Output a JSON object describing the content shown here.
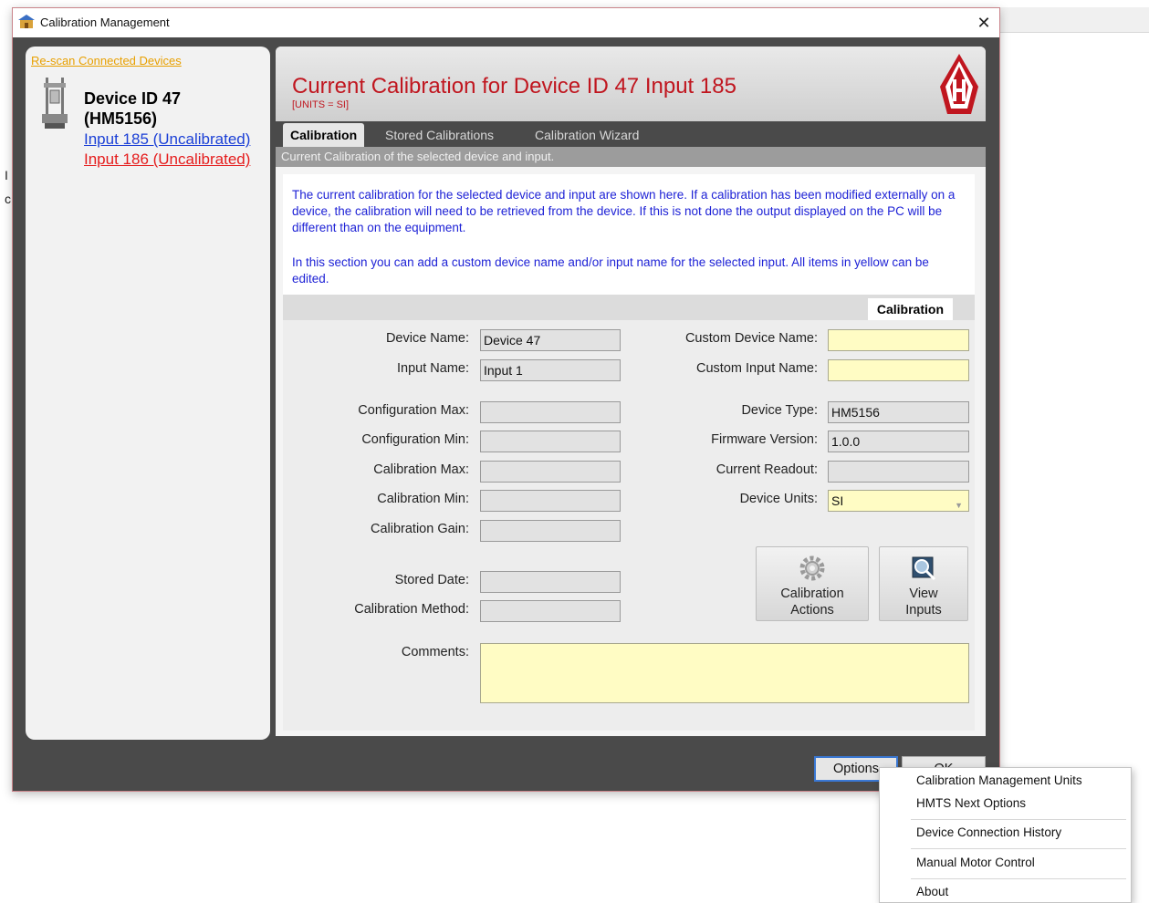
{
  "window": {
    "title": "Calibration Management",
    "close_glyph": "✕"
  },
  "left_panel": {
    "rescan_link": "Re-scan Connected Devices",
    "device_title_line1": "Device ID 47",
    "device_title_line2": "(HM5156)",
    "input_185": "Input 185 (Uncalibrated)",
    "input_186": "Input 186 (Uncalibrated)"
  },
  "header": {
    "title": "Current Calibration for Device ID 47 Input 185",
    "units": "[UNITS = SI]"
  },
  "tabs": [
    {
      "label": "Calibration",
      "active": true
    },
    {
      "label": "Stored Calibrations",
      "active": false
    },
    {
      "label": "Calibration Wizard",
      "active": false
    }
  ],
  "subheader": "Current Calibration of the selected device and input.",
  "descriptions": {
    "p1": "The current calibration for the selected device and input are shown here.  If a calibration has been modified externally on a device, the calibration will need to be retrieved from the device.  If this is not done the output displayed on the PC will be different than on the equipment.",
    "p2": "In this section you can add a custom device name and/or input name for the selected input.  All items in yellow can be edited."
  },
  "section_tab": "Calibration",
  "fields": {
    "device_name": {
      "label": "Device Name:",
      "value": "Device 47"
    },
    "input_name": {
      "label": "Input Name:",
      "value": "Input 1"
    },
    "config_max": {
      "label": "Configuration Max:",
      "value": ""
    },
    "config_min": {
      "label": "Configuration Min:",
      "value": ""
    },
    "cal_max": {
      "label": "Calibration Max:",
      "value": ""
    },
    "cal_min": {
      "label": "Calibration Min:",
      "value": ""
    },
    "cal_gain": {
      "label": "Calibration Gain:",
      "value": ""
    },
    "stored_date": {
      "label": "Stored Date:",
      "value": ""
    },
    "cal_method": {
      "label": "Calibration Method:",
      "value": ""
    },
    "custom_device_name": {
      "label": "Custom Device Name:",
      "value": ""
    },
    "custom_input_name": {
      "label": "Custom Input Name:",
      "value": ""
    },
    "device_type": {
      "label": "Device Type:",
      "value": "HM5156"
    },
    "firmware_version": {
      "label": "Firmware Version:",
      "value": "1.0.0"
    },
    "current_readout": {
      "label": "Current Readout:",
      "value": ""
    },
    "device_units": {
      "label": "Device Units:",
      "value": "SI"
    },
    "comments": {
      "label": "Comments:",
      "value": ""
    }
  },
  "action_buttons": {
    "calibration_actions_line1": "Calibration",
    "calibration_actions_line2": "Actions",
    "view_inputs_line1": "View",
    "view_inputs_line2": "Inputs"
  },
  "bottom_buttons": {
    "options": "Options",
    "ok": "OK"
  },
  "context_menu": {
    "items": [
      "Calibration Management Units",
      "HMTS Next Options",
      "Device Connection History",
      "Manual Motor Control",
      "About"
    ]
  },
  "colors": {
    "header_title": "#c0161f",
    "description_text": "#1e22d6",
    "link_orange": "#e8a000",
    "link_blue": "#1a3fd6",
    "link_red": "#e51c1c",
    "editable_yellow": "#fffcc4",
    "window_dark": "#4a4a4a"
  }
}
